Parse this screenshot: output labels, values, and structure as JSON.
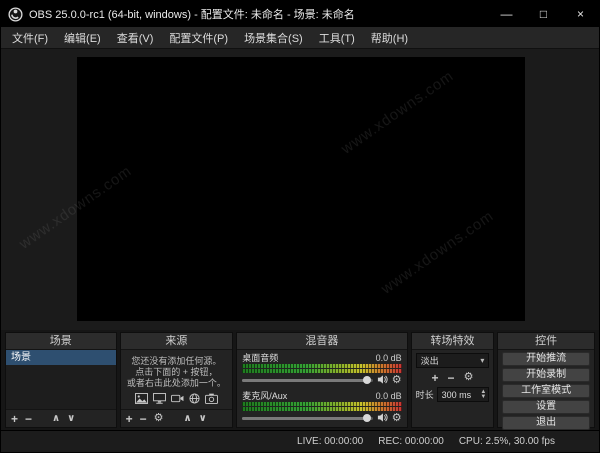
{
  "window": {
    "title": "OBS 25.0.0-rc1 (64-bit, windows) - 配置文件: 未命名 - 场景: 未命名",
    "controls": {
      "minimize": "—",
      "maximize": "□",
      "close": "×"
    }
  },
  "menu": {
    "items": [
      "文件(F)",
      "编辑(E)",
      "查看(V)",
      "配置文件(P)",
      "场景集合(S)",
      "工具(T)",
      "帮助(H)"
    ]
  },
  "watermark": {
    "text": "www.xdowns.com"
  },
  "icons": {
    "add": "+",
    "remove": "−",
    "config": "⚙",
    "up": "∧",
    "down": "∨",
    "dropdown": "▾",
    "spin_up": "▲",
    "spin_down": "▼"
  },
  "docks": {
    "scenes": {
      "title": "场景",
      "items": [
        "场景"
      ]
    },
    "sources": {
      "title": "来源",
      "empty_lines": [
        "您还没有添加任何源。",
        "点击下面的 + 按钮，",
        "或者右击此处添加一个。"
      ]
    },
    "mixer": {
      "title": "混音器",
      "channels": [
        {
          "name": "桌面音频",
          "level": "0.0 dB"
        },
        {
          "name": "麦克风/Aux",
          "level": "0.0 dB"
        }
      ]
    },
    "transitions": {
      "title": "转场特效",
      "selected": "淡出",
      "duration_label": "时长",
      "duration_value": "300 ms"
    },
    "controls": {
      "title": "控件",
      "buttons": [
        "开始推流",
        "开始录制",
        "工作室模式",
        "设置",
        "退出"
      ]
    }
  },
  "statusbar": {
    "live": "LIVE: 00:00:00",
    "rec": "REC: 00:00:00",
    "cpu": "CPU: 2.5%, 30.00 fps"
  },
  "colors": {
    "selection_blue": "#2e4f70",
    "meter_green": "#35a135",
    "meter_yellow": "#c9c22c",
    "meter_red": "#c93434",
    "titlebar": "#000000",
    "panel": "#232323"
  }
}
